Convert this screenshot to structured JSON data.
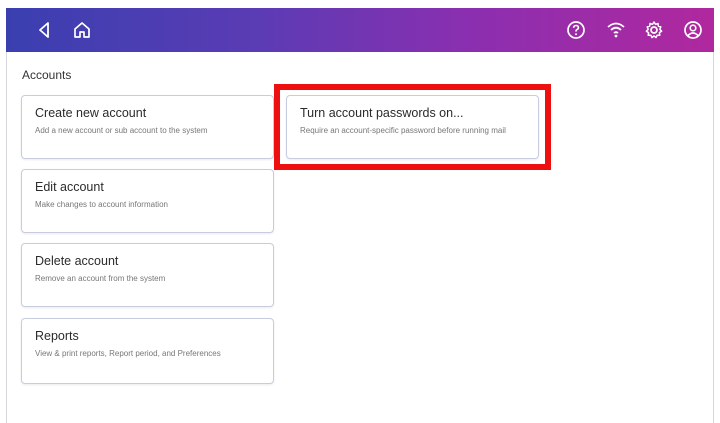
{
  "topbar": {
    "back_icon": "back-arrow-icon",
    "home_icon": "home-icon",
    "help_icon": "help-icon",
    "wifi_icon": "wifi-icon",
    "settings_icon": "gear-icon",
    "account_icon": "user-icon"
  },
  "page": {
    "title": "Accounts"
  },
  "cards": [
    {
      "title": "Create new account",
      "desc": "Add a new account or sub account to the system"
    },
    {
      "title": "Edit account",
      "desc": "Make changes to account information"
    },
    {
      "title": "Delete account",
      "desc": "Remove an account from the system"
    },
    {
      "title": "Reports",
      "desc": "View & print reports, Report period, and Preferences"
    }
  ],
  "password_card": {
    "title": "Turn account passwords on...",
    "desc": "Require an account-specific password before running mail"
  },
  "colors": {
    "highlight": "#ee1010",
    "bar_start": "#3a3fb0",
    "bar_end": "#b0289e"
  }
}
